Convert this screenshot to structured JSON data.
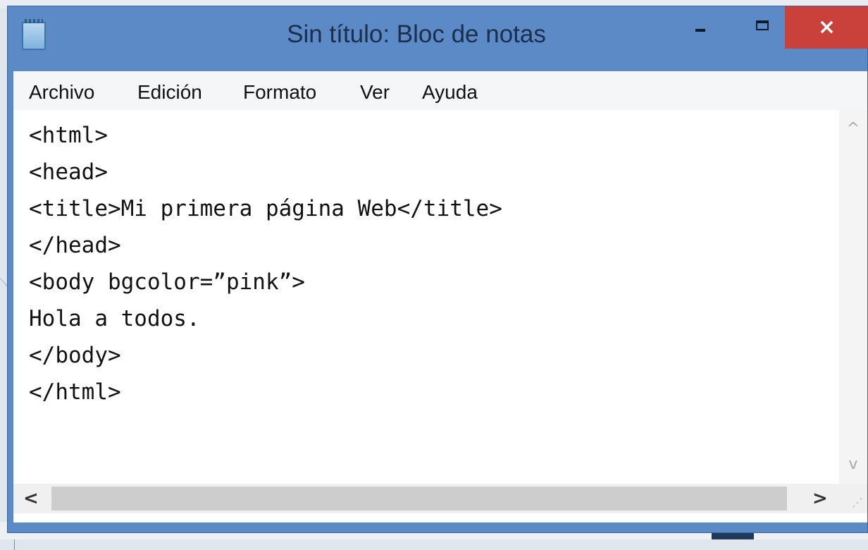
{
  "window": {
    "title": "Sin título: Bloc de notas",
    "close_glyph": "×",
    "titlebar_color": "#5b8ac6",
    "close_color": "#c9413a"
  },
  "menu": {
    "items": [
      "Archivo",
      "Edición",
      "Formato",
      "Ver",
      "Ayuda"
    ]
  },
  "editor": {
    "lines": [
      "<html>",
      "<head>",
      "<title>Mi primera página Web</title>",
      "</head>",
      "<body bgcolor=”pink”>",
      "Hola a todos.",
      "</body>",
      "</html>"
    ]
  },
  "scrollbars": {
    "up_glyph": "^",
    "down_glyph": "v",
    "left_glyph": "<",
    "right_glyph": ">"
  },
  "icons": {
    "app": "notepad-icon",
    "minimize": "minimize-icon",
    "maximize": "maximize-icon",
    "close": "close-icon"
  }
}
